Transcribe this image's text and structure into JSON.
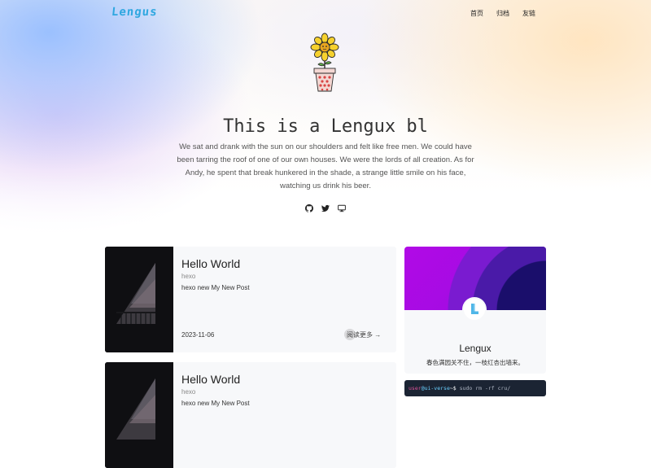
{
  "header": {
    "logo": "Lengus",
    "nav": [
      "首页",
      "归档",
      "友链"
    ]
  },
  "hero": {
    "icon": "flower-pot-illustration",
    "title": "This is a Lengux bl",
    "subtitle": "We sat and drank with the sun on our shoulders and felt like free men. We could have been tarring the roof of one of our own houses. We were the lords of all creation. As for Andy, he spent that break hunkered in the shade, a strange little smile on his face, watching us drink his beer.",
    "social_icons": [
      "github-icon",
      "twitter-icon",
      "monitor-icon"
    ]
  },
  "posts": [
    {
      "title": "Hello World",
      "category": "hexo",
      "excerpt": "hexo new My New Post",
      "date": "2023-11-06",
      "read_more": "阅读更多 →"
    },
    {
      "title": "Hello World",
      "category": "hexo",
      "excerpt": "hexo new My New Post"
    }
  ],
  "profile": {
    "name": "Lengux",
    "motto": "春色满园关不住，一枝红杏出墙来。"
  },
  "terminal": {
    "user": "user",
    "host": "@ui-verse",
    "prompt": "~$",
    "command": " sudo rm -rf cru/"
  },
  "colors": {
    "logo": "#2fa7e0",
    "banner_purple": "#b10ae6",
    "terminal_bg": "#1b2433"
  }
}
